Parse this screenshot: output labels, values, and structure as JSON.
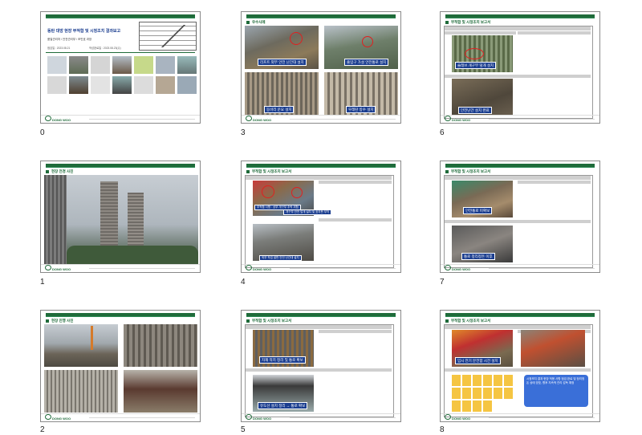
{
  "slides": [
    {
      "index": "0",
      "title": "동탄 대방 현장 부적합 및 시정조치 결과보고",
      "dept": "품질관리처 / 안전관리부 / 조민호 과장",
      "date1": "점검일 : 2023.08.21",
      "date2": "작성완료일 : 2023.08.23(수)"
    },
    {
      "index": "1",
      "section": "현장 전경 사진"
    },
    {
      "index": "2",
      "section": "현장 진행 사진"
    },
    {
      "index": "3",
      "section": "우수사례",
      "captions": [
        "리프트 외부 안전 난간대 설치",
        "출입구 가설 안전통로 설치",
        "동바리 운요 설치",
        "우레탄 방수 설치"
      ]
    },
    {
      "index": "4",
      "section": "부적합 및 시정조치 보고서",
      "captions": [
        "부적합 사항 : 상부 개구부 추락 위험",
        "개구부 안전 덮개 설치 및 표지판 부착",
        "외부 작업 발판 안전 난간대 설치"
      ]
    },
    {
      "index": "5",
      "section": "부적합 및 시정조치 보고서",
      "captions": [
        "자재 적치 정리 및 통로 확보",
        "유도선 설치 정리 → 통로 확보"
      ]
    },
    {
      "index": "6",
      "section": "부적합 및 시정조치 보고서",
      "captions": [
        "슬래브 개구부 덮개 설치",
        "안전난간 설치 완료"
      ]
    },
    {
      "index": "7",
      "section": "부적합 및 시정조치 보고서",
      "captions": [
        "안전통로 미확보",
        "통로 정리정돈 이후"
      ]
    },
    {
      "index": "8",
      "section": "부적합 및 시정조치 보고서",
      "captions": [
        "임시 전기 분전함 시건 설치"
      ],
      "note": "시정조치 결과 현장 적용 사항 점검 완료 및 정리정돈 상태 양호, 향후 지속적 관리 감독 예정"
    }
  ],
  "footer_text": "DONG WOO",
  "table_headers": [
    "점검항목",
    "점검 일자",
    "조치 일자",
    "확인자"
  ]
}
